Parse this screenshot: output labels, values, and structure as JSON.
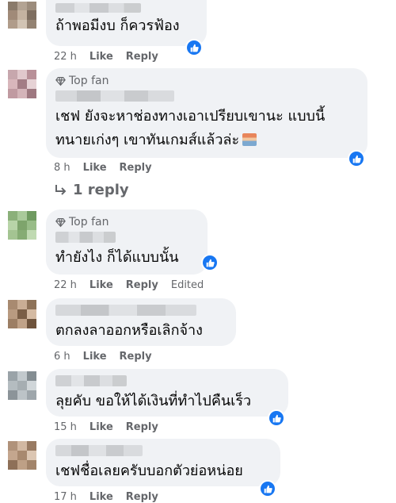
{
  "comments": [
    {
      "text": "ถ้าพอมีงบ ก็ควรฟ้อง",
      "time": "22 h",
      "like_label": "Like",
      "reply_label": "Reply"
    },
    {
      "badge": "Top fan",
      "line1": "เชฟ ยังจะหาช่องทางเอาเปรียบเขานะ แบบนี้",
      "line2": "ทนายเก่งๆ เขาทันเกมส์แล้วล่ะ",
      "emoji": "🏪",
      "time": "8 h",
      "like_label": "Like",
      "reply_label": "Reply",
      "replies_label": "1 reply"
    },
    {
      "badge": "Top fan",
      "text": "ทำยังไง ก็ได้แบบนั้น",
      "time": "22 h",
      "like_label": "Like",
      "reply_label": "Reply",
      "edited_label": "Edited"
    },
    {
      "text": "ตกลงลาออกหรือเลิกจ้าง",
      "time": "6 h",
      "like_label": "Like",
      "reply_label": "Reply"
    },
    {
      "text": "ลุยคับ ขอให้ได้เงินที่ทำไปคืนเร็ว",
      "time": "15 h",
      "like_label": "Like",
      "reply_label": "Reply"
    },
    {
      "text": "เชฟชื่อเลยครับบอกตัวย่อหน่อย",
      "time": "17 h",
      "like_label": "Like",
      "reply_label": "Reply"
    }
  ],
  "colors": {
    "bubble": "#f0f2f5",
    "meta_text": "#65676b",
    "like_blue": "#1877f2"
  },
  "icons": {
    "like_reaction": "thumbs-up-icon",
    "top_fan": "diamond-icon",
    "reply_arrow": "reply-arrow-icon"
  }
}
